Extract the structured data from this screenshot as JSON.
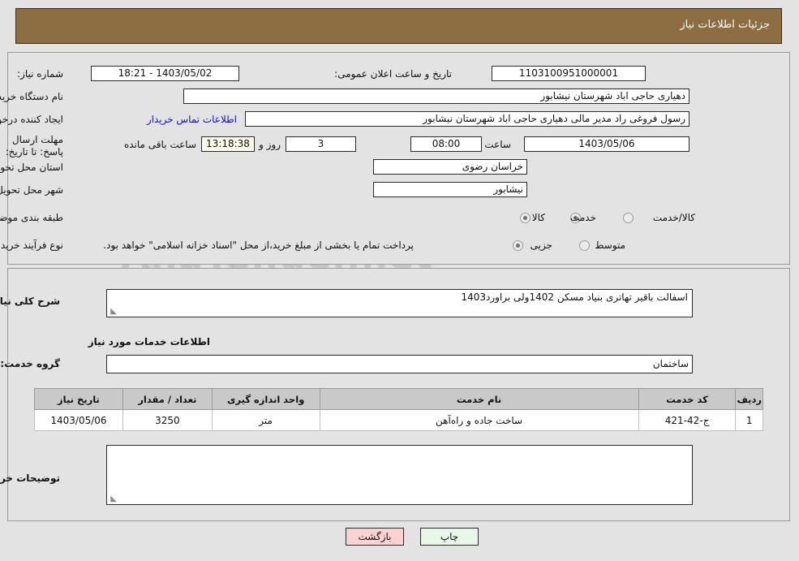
{
  "header": {
    "title": "جزئیات اطلاعات نیاز",
    "bg_color": "#8d6e42"
  },
  "watermark": {
    "text": "AnaTender.net"
  },
  "top_panel": {
    "need_number_label": "شماره نیاز:",
    "need_number_value": "1103100951000001",
    "public_announce_label": "تاریخ و ساعت اعلان عمومی:",
    "public_announce_value": "1403/05/02 - 18:21",
    "buyer_org_label": "نام دستگاه خریدار:",
    "buyer_org_value": "دهیاری حاجی اباد شهرستان نیشابور",
    "creator_label": "ایجاد کننده درخواست:",
    "creator_value": "رسول فروغی راد مدیر مالی دهیاری حاجی اباد شهرستان نیشابور",
    "contact_link": "اطلاعات تماس خریدار",
    "deadline_label": "مهلت ارسال پاسخ: تا تاریخ:",
    "deadline_date": "1403/05/06",
    "hour_label": "ساعت",
    "hour_value": "08:00",
    "days_value": "3",
    "days_label": "روز و",
    "countdown_value": "13:18:38",
    "countdown_label": "ساعت باقی مانده",
    "province_label": "استان محل تحویل:",
    "province_value": "خراسان رضوی",
    "city_label": "شهر محل تحویل:",
    "city_value": "نیشابور",
    "category_label": "طبقه بندی موضوعی:",
    "category_options": [
      {
        "label": "کالا",
        "selected": false
      },
      {
        "label": "خدمت",
        "selected": true
      },
      {
        "label": "کالا/خدمت",
        "selected": false
      }
    ],
    "process_label": "نوع فرآیند خرید :",
    "process_options": [
      {
        "label": "جزیی",
        "selected": true
      },
      {
        "label": "متوسط",
        "selected": false
      }
    ],
    "payment_note": "پرداخت تمام یا بخشی از مبلغ خرید،از محل \"اسناد خزانه اسلامی\" خواهد بود."
  },
  "bottom_panel": {
    "summary_label": "شرح کلی نیاز:",
    "summary_value": "اسفالت باقیر تهاتری بنیاد مسکن 1402ولی براورد1403",
    "services_section_title": "اطلاعات خدمات مورد نیاز",
    "service_group_label": "گروه خدمت:",
    "service_group_value": "ساختمان",
    "buyer_notes_label": "توضیحات خریدار:",
    "buyer_notes_value": ""
  },
  "table": {
    "columns": [
      "ردیف",
      "کد خدمت",
      "نام خدمت",
      "واحد اندازه گیری",
      "تعداد / مقدار",
      "تاریخ نیاز"
    ],
    "rows": [
      {
        "row_no": "1",
        "service_code": "ج-42-421",
        "service_name": "ساخت جاده و راه‌آهن",
        "unit": "متر",
        "quantity": "3250",
        "need_date": "1403/05/06"
      }
    ]
  },
  "footer": {
    "print_label": "چاپ",
    "back_label": "بازگشت"
  }
}
